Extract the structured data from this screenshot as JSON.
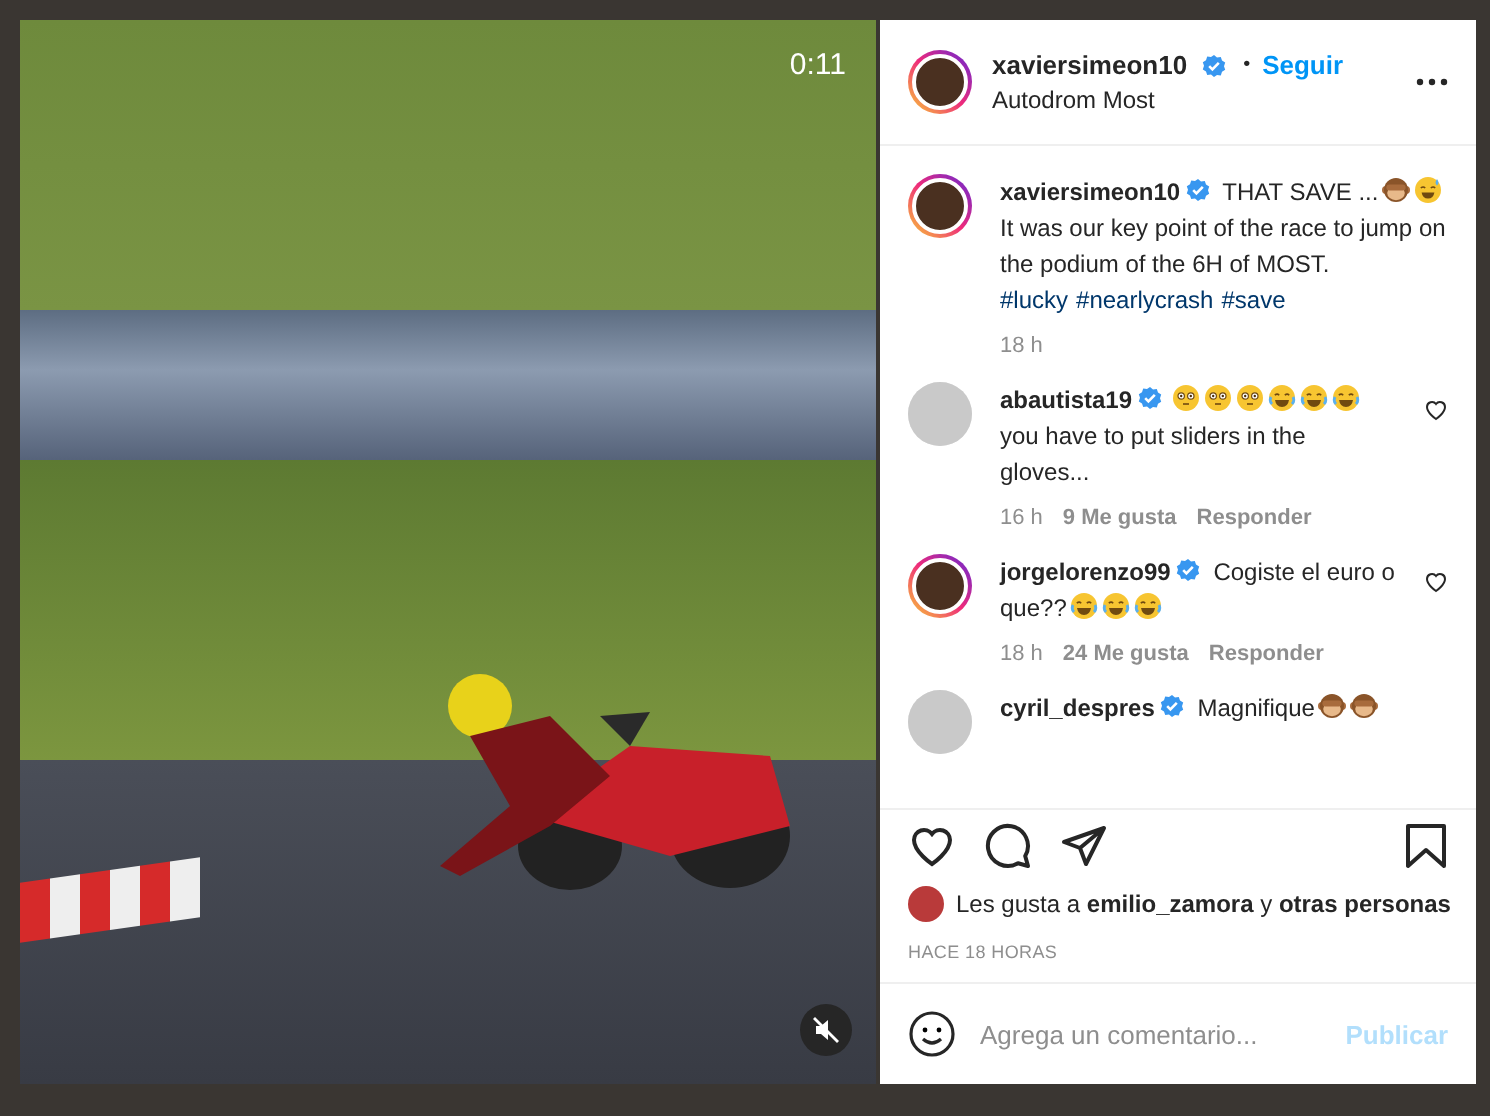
{
  "video": {
    "time": "0:11",
    "muted": true
  },
  "header": {
    "username": "xaviersimeon10",
    "verified": true,
    "separator": "•",
    "follow": "Seguir",
    "location": "Autodrom Most"
  },
  "caption": {
    "username": "xaviersimeon10",
    "verified": true,
    "text_before": "THAT SAVE ...",
    "emojis": [
      {
        "kind": "monkey"
      },
      {
        "kind": "sweat"
      }
    ],
    "text_after": "It was our key point of the race to jump on the podium of the 6H of MOST.",
    "hashtags": [
      "#lucky",
      "#nearlycrash",
      "#save"
    ],
    "time": "18 h"
  },
  "comments": [
    {
      "username": "abautista19",
      "verified": true,
      "story_ring": false,
      "emojis": [
        {
          "kind": "flushed"
        },
        {
          "kind": "flushed"
        },
        {
          "kind": "flushed"
        },
        {
          "kind": "laugh"
        },
        {
          "kind": "laugh"
        },
        {
          "kind": "laugh"
        }
      ],
      "text": "you have to put sliders in the gloves...",
      "time": "16 h",
      "likes": "9 Me gusta",
      "reply": "Responder"
    },
    {
      "username": "jorgelorenzo99",
      "verified": true,
      "story_ring": true,
      "text": "Cogiste el euro o que??",
      "emojis_after": [
        {
          "kind": "laugh"
        },
        {
          "kind": "laugh"
        },
        {
          "kind": "laugh"
        }
      ],
      "time": "18 h",
      "likes": "24 Me gusta",
      "reply": "Responder"
    },
    {
      "username": "cyril_despres",
      "verified": true,
      "story_ring": false,
      "text": "Magnifique",
      "emojis_after": [
        {
          "kind": "monkey"
        },
        {
          "kind": "monkey"
        }
      ]
    }
  ],
  "likes_line": {
    "prefix": "Les gusta a",
    "user": "emilio_zamora",
    "middle": "y",
    "others": "otras personas"
  },
  "posted": "HACE 18 HORAS",
  "comment_box": {
    "placeholder": "Agrega un comentario...",
    "submit": "Publicar",
    "submit_disabled": true
  }
}
